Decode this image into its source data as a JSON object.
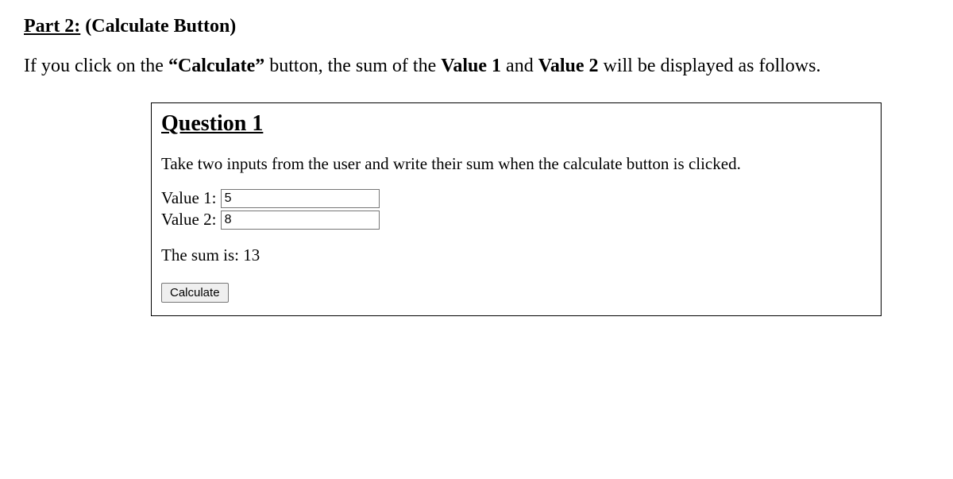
{
  "heading_part": "Part 2:",
  "heading_rest": " (Calculate Button)",
  "description_html": "If you click on the <b>“Calculate”</b> button, the sum of the <b>Value 1</b> and <b>Value 2</b> will be displayed as follows.",
  "box": {
    "title": "Question 1",
    "instruction": "Take two inputs from the user and write their sum when the calculate button is clicked.",
    "field1_label": "Value 1: ",
    "field1_value": "5",
    "field2_label": "Value 2: ",
    "field2_value": "8",
    "result_text": "The sum is: 13",
    "button_label": "Calculate"
  }
}
